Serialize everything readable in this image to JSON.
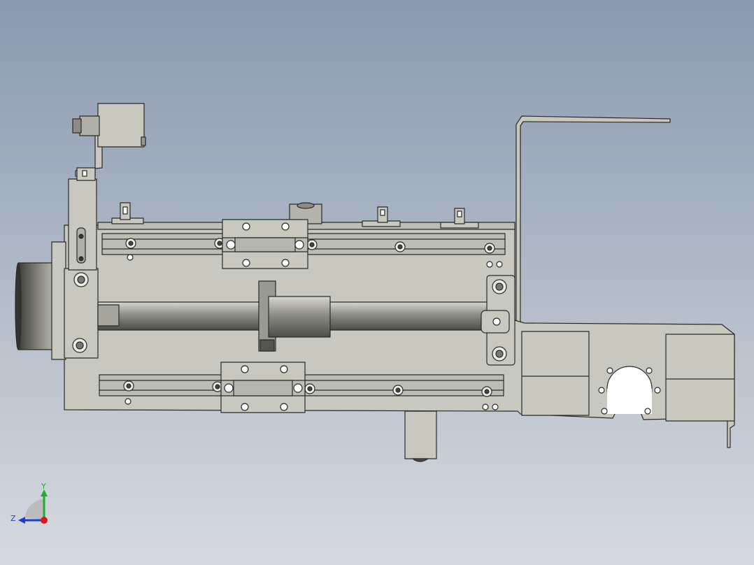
{
  "colors": {
    "part": "#c8c8be",
    "part_dark": "#a9a99e",
    "edge": "#2a2a2a",
    "rail": "#bdbdb3",
    "screw": "#6e6e6a",
    "shaft": "#8c8c84",
    "motor": "#55554f",
    "axis_y": "#1fae2c",
    "axis_z": "#1f3fd0",
    "axis_x": "#e01515"
  },
  "triad": {
    "y_label": "Y",
    "z_label": "Z"
  }
}
